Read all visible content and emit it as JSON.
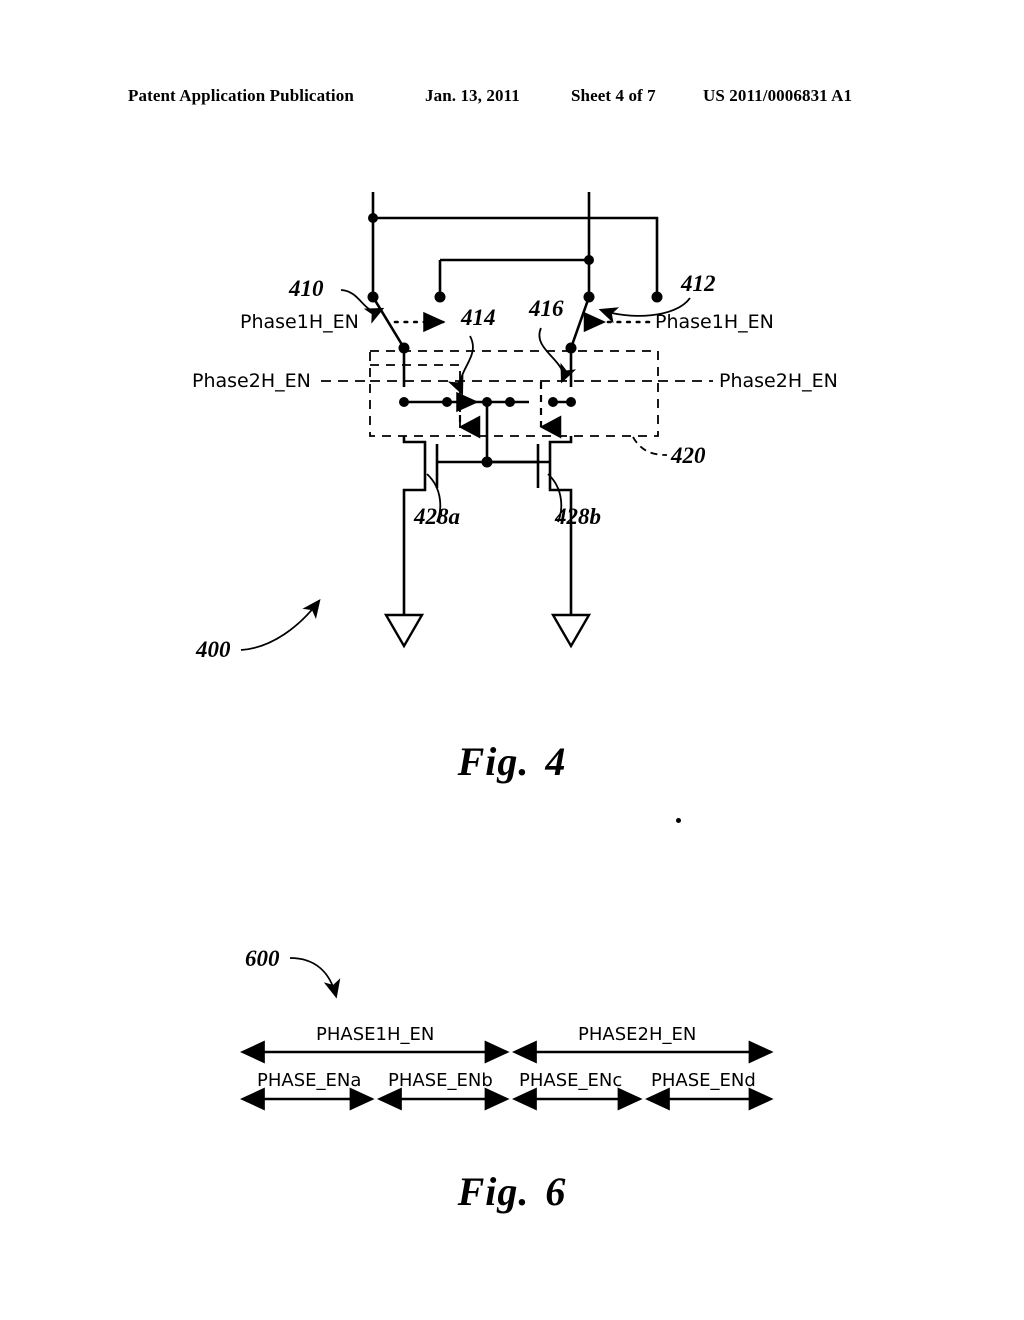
{
  "header": {
    "publication": "Patent Application Publication",
    "date": "Jan. 13, 2011",
    "sheet": "Sheet 4 of 7",
    "patent_number": "US 2011/0006831 A1"
  },
  "fig4": {
    "caption_word": "Fig.",
    "caption_number": "4",
    "figure_ref": "400",
    "labels": {
      "phase1h_en_left": "Phase1H_EN",
      "phase1h_en_right": "Phase1H_EN",
      "phase2h_en_left": "Phase2H_EN",
      "phase2h_en_right": "Phase2H_EN"
    },
    "refs": {
      "switch_left": "410",
      "switch_right": "412",
      "flow_left": "414",
      "flow_right": "416",
      "dashed_region": "420",
      "transistor_left": "428a",
      "transistor_right": "428b"
    }
  },
  "fig6": {
    "caption_word": "Fig.",
    "caption_number": "6",
    "figure_ref": "600",
    "upper_intervals": [
      {
        "label": "PHASE1H_EN"
      },
      {
        "label": "PHASE2H_EN"
      }
    ],
    "lower_intervals": [
      {
        "label": "PHASE_ENa"
      },
      {
        "label": "PHASE_ENb"
      },
      {
        "label": "PHASE_ENc"
      },
      {
        "label": "PHASE_ENd"
      }
    ]
  }
}
